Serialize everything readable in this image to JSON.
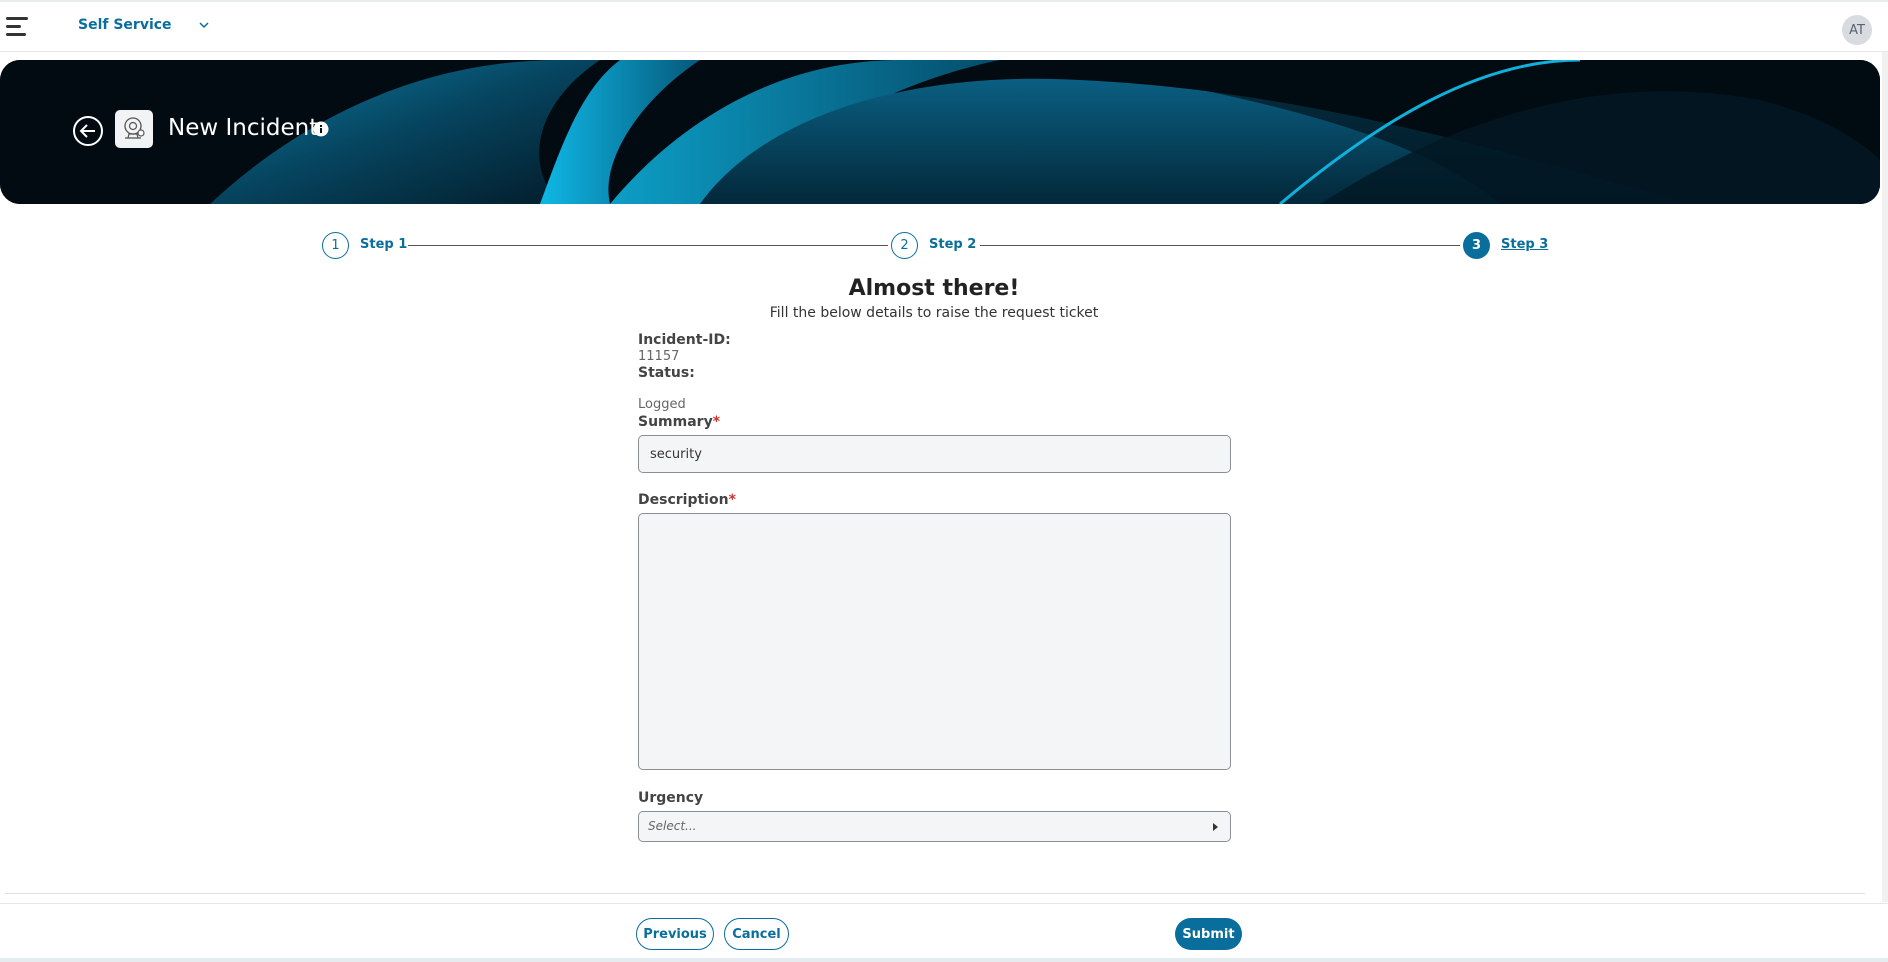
{
  "topbar": {
    "app_name": "Self Service",
    "avatar_initials": "AT",
    "menu_icon": "hamburger-menu-icon",
    "chevron_icon": "chevron-down-icon"
  },
  "banner": {
    "title": "New Incident",
    "back_icon": "arrow-left-circle-icon",
    "logo_icon": "incident-agent-icon",
    "info_icon": "info-icon"
  },
  "stepper": {
    "steps": [
      {
        "number": "1",
        "label": "Step 1",
        "active": false
      },
      {
        "number": "2",
        "label": "Step 2",
        "active": false
      },
      {
        "number": "3",
        "label": "Step 3",
        "active": true
      }
    ]
  },
  "form": {
    "heading": "Almost there!",
    "subheading": "Fill the below details to raise the request ticket",
    "incident_id_label": "Incident-ID:",
    "incident_id_value": "11157",
    "status_label": "Status:",
    "status_value": "Logged",
    "summary_label": "Summary",
    "summary_value": "security",
    "description_label": "Description",
    "description_value": "",
    "required_marker": "*",
    "urgency_label": "Urgency",
    "urgency_placeholder": "Select..."
  },
  "footer": {
    "previous_label": "Previous",
    "cancel_label": "Cancel",
    "submit_label": "Submit"
  },
  "colors": {
    "accent": "#0a6e9c",
    "required": "#d32f2f",
    "banner_bg": "#020c14"
  }
}
